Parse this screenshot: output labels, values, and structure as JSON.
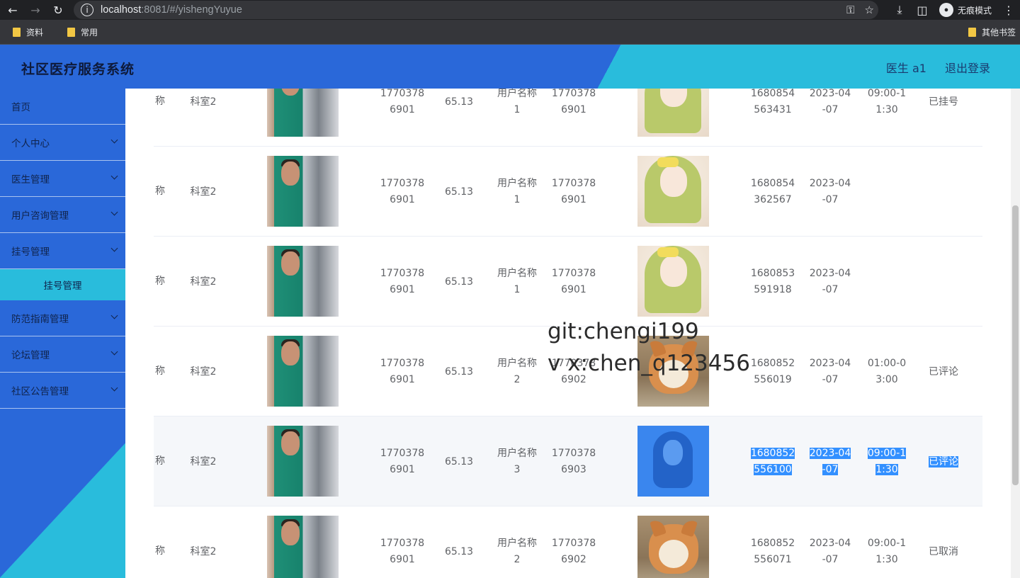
{
  "browser": {
    "url_host": "localhost",
    "url_path": ":8081/#/yishengYuyue",
    "incognito_label": "无痕模式",
    "bookmarks": [
      "资料",
      "常用"
    ],
    "other_bookmarks": "其他书签"
  },
  "header": {
    "title": "社区医疗服务系统",
    "user": "医生 a1",
    "logout": "退出登录"
  },
  "sidebar": {
    "items": [
      {
        "label": "首页"
      },
      {
        "label": "个人中心"
      },
      {
        "label": "医生管理"
      },
      {
        "label": "用户咨询管理"
      },
      {
        "label": "挂号管理"
      },
      {
        "sub": "挂号管理"
      },
      {
        "label": "防范指南管理"
      },
      {
        "label": "论坛管理"
      },
      {
        "label": "社区公告管理"
      }
    ]
  },
  "table": {
    "rows": [
      {
        "name": "称",
        "dept": "科室2",
        "phone_a": "1770378",
        "phone_b": "6901",
        "fee": "65.13",
        "user_a": "用户名称",
        "user_b": "1",
        "uphone_a": "1770378",
        "uphone_b": "6901",
        "order_a": "1680854",
        "order_b": "563431",
        "date_a": "2023-04",
        "date_b": "-07",
        "time_a": "09:00-1",
        "time_b": "1:30",
        "status": "已挂号",
        "avatar": "anime-icon"
      },
      {
        "name": "称",
        "dept": "科室2",
        "phone_a": "1770378",
        "phone_b": "6901",
        "fee": "65.13",
        "user_a": "用户名称",
        "user_b": "1",
        "uphone_a": "1770378",
        "uphone_b": "6901",
        "order_a": "1680854",
        "order_b": "362567",
        "date_a": "2023-04",
        "date_b": "-07",
        "time_a": "",
        "time_b": "",
        "status": "",
        "avatar": "anime-icon"
      },
      {
        "name": "称",
        "dept": "科室2",
        "phone_a": "1770378",
        "phone_b": "6901",
        "fee": "65.13",
        "user_a": "用户名称",
        "user_b": "1",
        "uphone_a": "1770378",
        "uphone_b": "6901",
        "order_a": "1680853",
        "order_b": "591918",
        "date_a": "2023-04",
        "date_b": "-07",
        "time_a": "",
        "time_b": "",
        "status": "",
        "avatar": "anime-icon"
      },
      {
        "name": "称",
        "dept": "科室2",
        "phone_a": "1770378",
        "phone_b": "6901",
        "fee": "65.13",
        "user_a": "用户名称",
        "user_b": "2",
        "uphone_a": "1770378",
        "uphone_b": "6902",
        "order_a": "1680852",
        "order_b": "556019",
        "date_a": "2023-04",
        "date_b": "-07",
        "time_a": "01:00-0",
        "time_b": "3:00",
        "status": "已评论",
        "avatar": "dog-icon"
      },
      {
        "name": "称",
        "dept": "科室2",
        "phone_a": "1770378",
        "phone_b": "6901",
        "fee": "65.13",
        "user_a": "用户名称",
        "user_b": "3",
        "uphone_a": "1770378",
        "uphone_b": "6903",
        "order_a": "1680852",
        "order_b": "556100",
        "date_a": "2023-04",
        "date_b": "-07",
        "time_a": "09:00-1",
        "time_b": "1:30",
        "status": "已评论",
        "avatar": "woman-icon"
      },
      {
        "name": "称",
        "dept": "科室2",
        "phone_a": "1770378",
        "phone_b": "6901",
        "fee": "65.13",
        "user_a": "用户名称",
        "user_b": "2",
        "uphone_a": "1770378",
        "uphone_b": "6902",
        "order_a": "1680852",
        "order_b": "556071",
        "date_a": "2023-04",
        "date_b": "-07",
        "time_a": "09:00-1",
        "time_b": "1:30",
        "status": "已取消",
        "avatar": "dog-icon"
      }
    ]
  },
  "watermark": {
    "line1": "git:chengi199",
    "line2": "v x:chen_q123456"
  }
}
